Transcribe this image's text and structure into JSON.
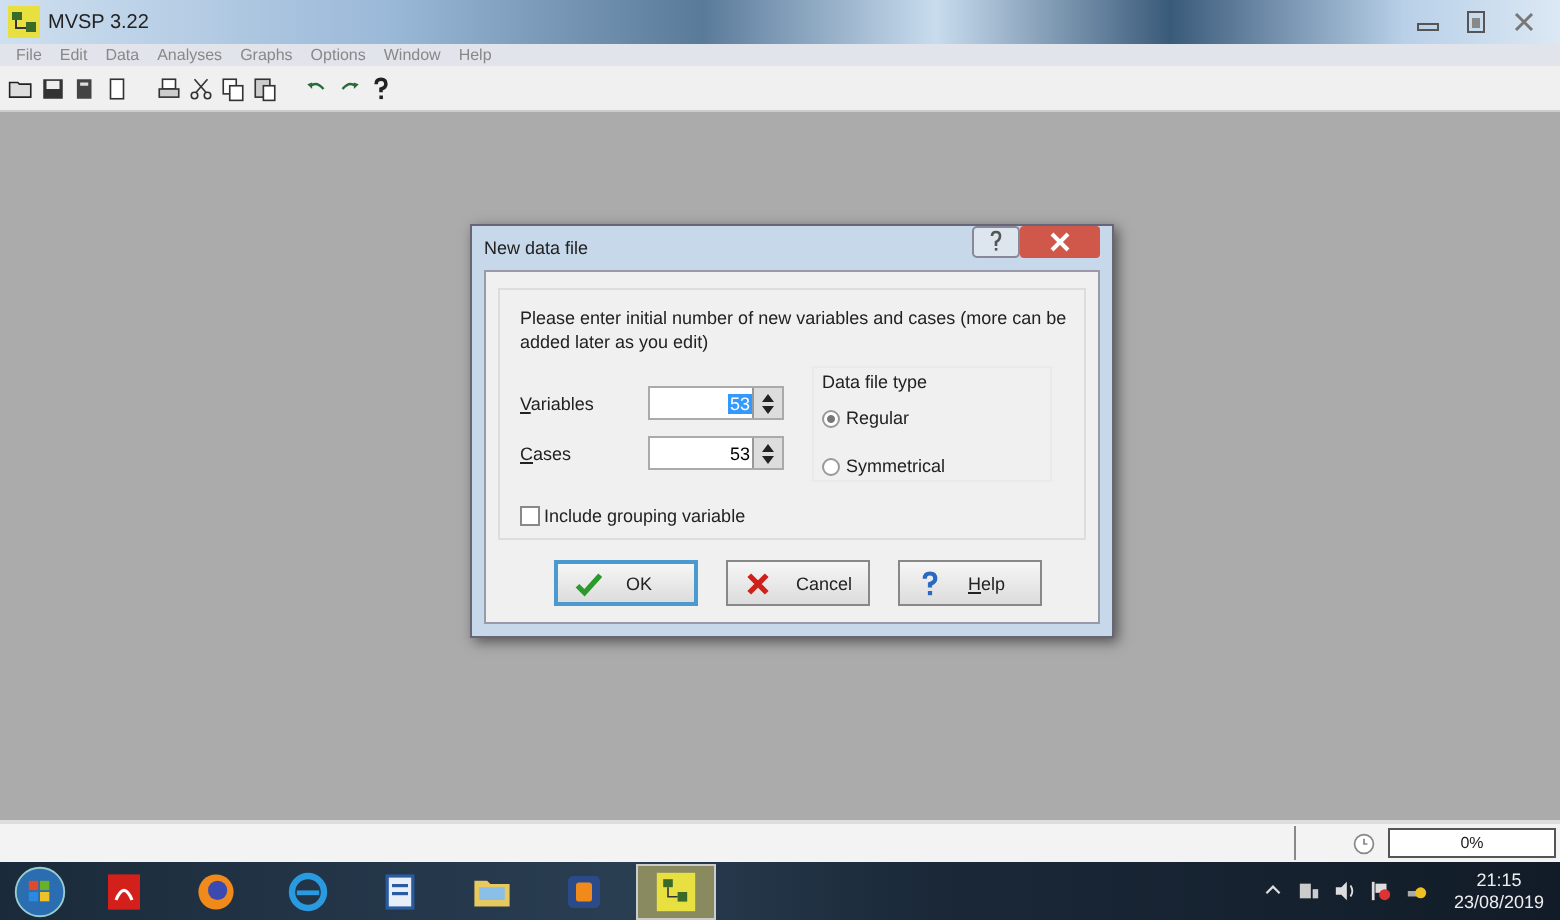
{
  "window": {
    "title": "MVSP 3.22"
  },
  "menu": [
    "File",
    "Edit",
    "Data",
    "Analyses",
    "Graphs",
    "Options",
    "Window",
    "Help"
  ],
  "dialog": {
    "title": "New data file",
    "prompt": "Please enter initial number of new variables and cases (more can be added later as you edit)",
    "fields": [
      {
        "label": "Variables",
        "value": "53",
        "selected": true
      },
      {
        "label": "Cases",
        "value": "53",
        "selected": false
      }
    ],
    "group": {
      "title": "Data file type",
      "options": [
        {
          "label": "Regular",
          "selected": true
        },
        {
          "label": "Symmetrical",
          "selected": false
        }
      ]
    },
    "checkbox": {
      "label": "Include grouping variable",
      "checked": false
    },
    "buttons": [
      {
        "label": "OK",
        "kind": "ok",
        "focused": true
      },
      {
        "label": "Cancel",
        "kind": "cancel",
        "focused": false
      },
      {
        "label": "Help",
        "kind": "help",
        "focused": false
      }
    ]
  },
  "status_bar": {
    "progress": {
      "level": 0,
      "reading": "0%"
    }
  },
  "taskbar": {
    "apps": [
      {
        "kind": "pdf",
        "active": false
      },
      {
        "kind": "firefox",
        "active": false
      },
      {
        "kind": "ie",
        "active": false
      },
      {
        "kind": "word",
        "active": false
      },
      {
        "kind": "folder",
        "active": false
      },
      {
        "kind": "media",
        "active": false
      },
      {
        "kind": "mvsp",
        "active": true
      }
    ],
    "time": "21:15",
    "date": "23/08/2019"
  }
}
